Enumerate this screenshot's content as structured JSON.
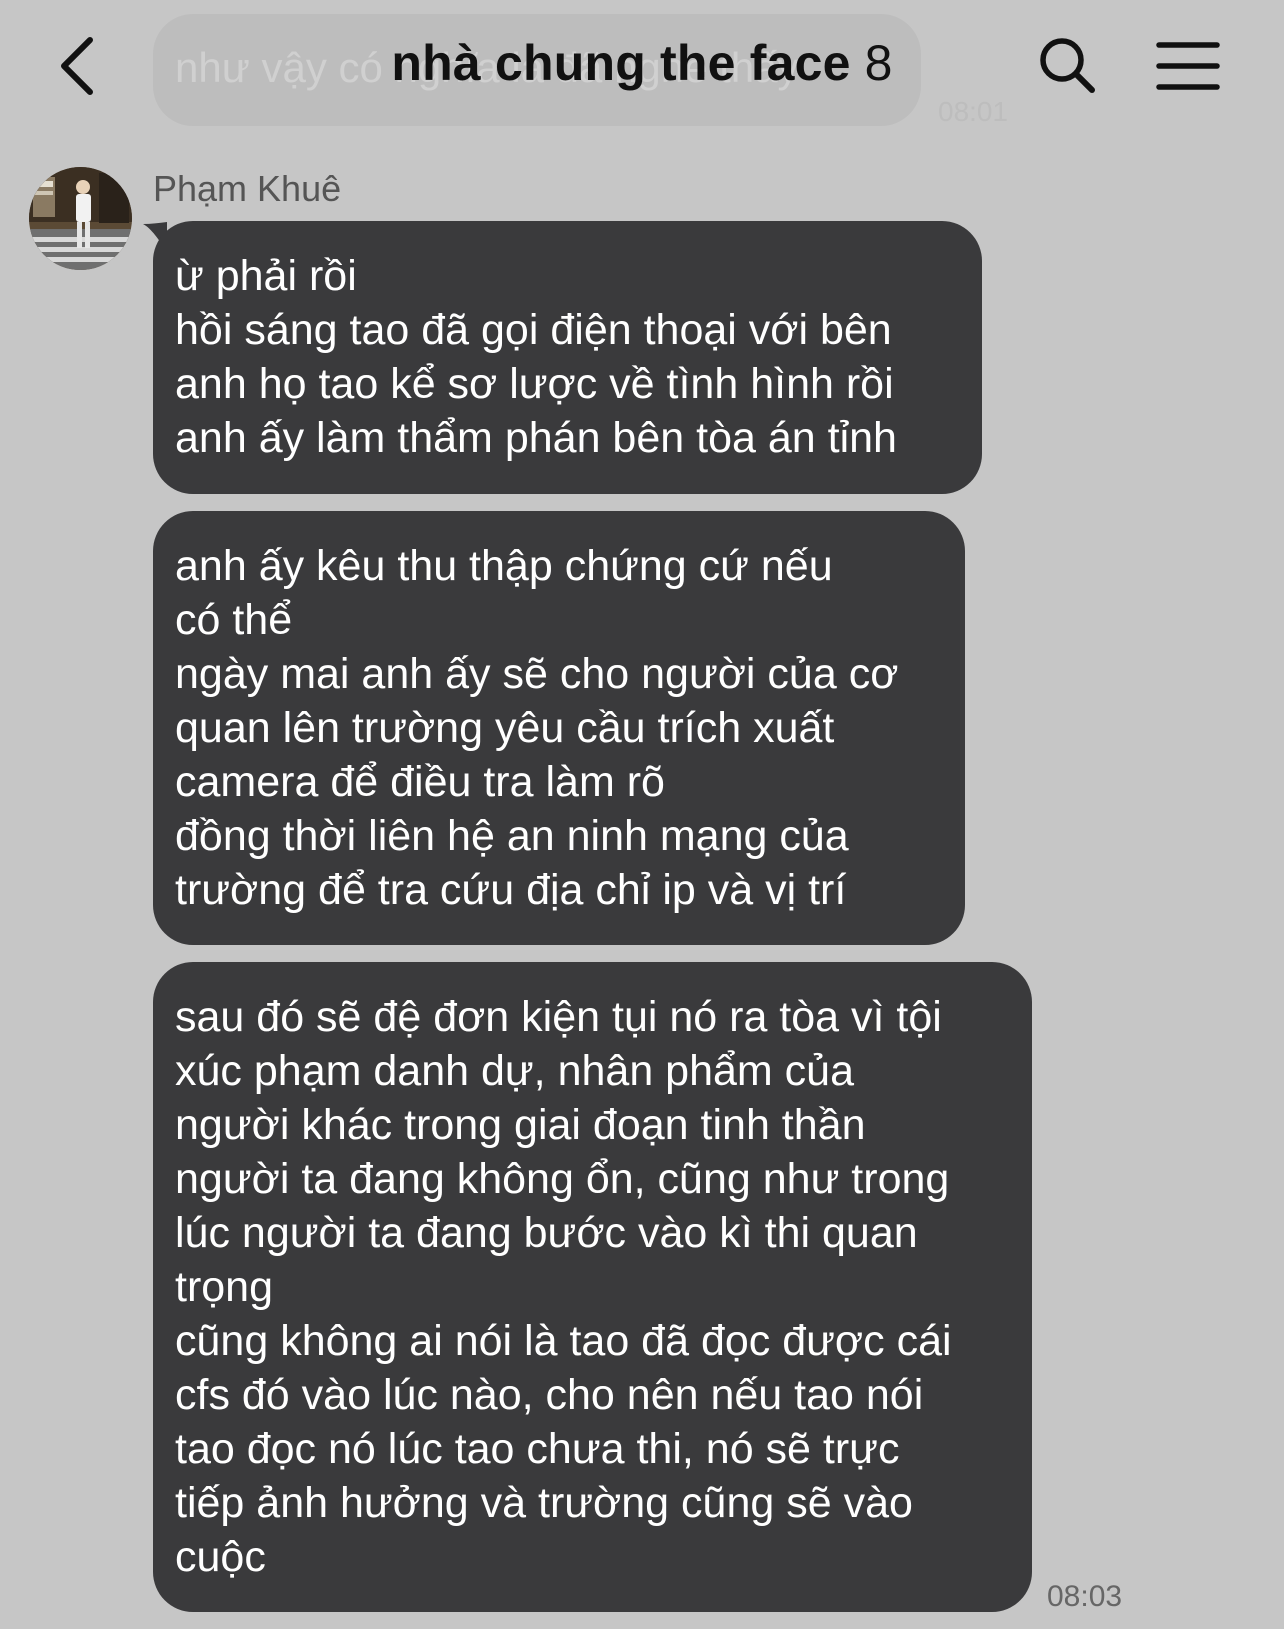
{
  "header": {
    "title": "nhà chung the face",
    "member_count": "8",
    "ghost_message": "như vậy có nghĩa là đã nghe thấy",
    "ghost_time": "08:01"
  },
  "message_group": {
    "sender": "Phạm Khuê",
    "time": "08:03",
    "bubbles": [
      {
        "lines": [
          "ừ phải rồi",
          "hồi sáng tao đã gọi điện thoại với bên",
          "anh họ tao kể sơ lược về tình hình rồi",
          "anh ấy làm thẩm phán bên tòa án tỉnh"
        ]
      },
      {
        "lines": [
          "anh ấy kêu thu thập chứng cứ nếu",
          "có thể",
          "ngày mai anh ấy sẽ cho người của cơ",
          "quan lên trường yêu cầu trích xuất",
          "camera để điều tra làm rõ",
          "đồng thời liên hệ an ninh mạng của",
          "trường để tra cứu địa chỉ ip và vị trí"
        ]
      },
      {
        "lines": [
          "sau đó sẽ đệ đơn kiện tụi nó ra tòa vì tội",
          "xúc phạm danh dự, nhân phẩm của",
          "người khác trong giai đoạn tinh thần",
          "người ta đang không ổn, cũng như trong",
          "lúc người ta đang bước vào kì thi quan",
          "trọng",
          "cũng không ai nói là tao đã đọc được cái",
          "cfs đó vào lúc nào, cho nên nếu tao nói",
          "tao đọc nó lúc tao chưa thi, nó sẽ trực",
          "tiếp ảnh hưởng và trường cũng sẽ vào",
          "cuộc"
        ]
      }
    ]
  },
  "icons": {
    "back": "chevron-left-icon",
    "search": "search-icon",
    "menu": "hamburger-menu-icon"
  },
  "colors": {
    "background": "#c6c6c6",
    "bubble": "#3a3a3c",
    "bubble_text": "#ffffff",
    "title_text": "#111111",
    "meta_text": "#555555"
  }
}
